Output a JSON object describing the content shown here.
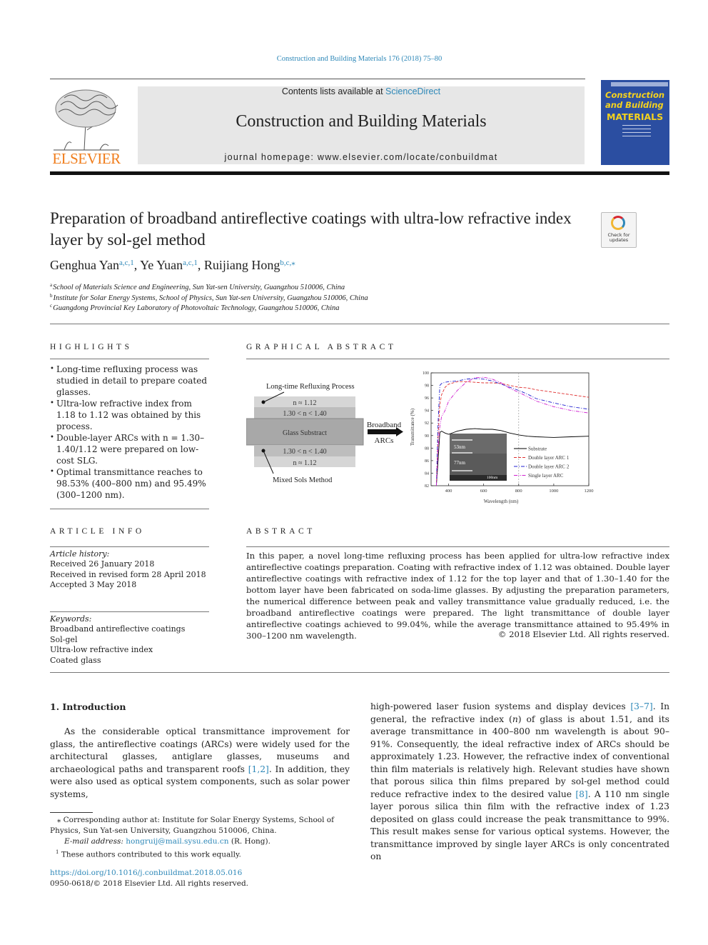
{
  "header": {
    "citation": "Construction and Building Materials 176 (2018) 75–80",
    "contents_prefix": "Contents lists available at ",
    "contents_link": "ScienceDirect",
    "journal_name": "Construction and Building Materials",
    "homepage": "journal homepage: www.elsevier.com/locate/conbuildmat",
    "publisher_logo_text": "ELSEVIER",
    "cover": {
      "line1": "Construction",
      "line2": "and Building",
      "line3": "MATERIALS"
    }
  },
  "article": {
    "title": "Preparation of broadband antireflective coatings with ultra-low refractive index layer by sol-gel method",
    "check_badge": {
      "line1": "Check for",
      "line2": "updates"
    },
    "authors": [
      {
        "name": "Genghua Yan",
        "sup": "a,c,1",
        "sep": ", "
      },
      {
        "name": "Ye Yuan",
        "sup": "a,c,1",
        "sep": ", "
      },
      {
        "name": "Ruijiang Hong",
        "sup": "b,c,⁎",
        "sep": ""
      }
    ],
    "affiliations": [
      {
        "mark": "a",
        "text": "School of Materials Science and Engineering, Sun Yat-sen University, Guangzhou 510006, China"
      },
      {
        "mark": "b",
        "text": "Institute for Solar Energy Systems, School of Physics, Sun Yat-sen University, Guangzhou 510006, China"
      },
      {
        "mark": "c",
        "text": "Guangdong Provincial Key Laboratory of Photovoltaic Technology, Guangzhou 510006, China"
      }
    ]
  },
  "highlights": {
    "heading": "HIGHLIGHTS",
    "items": [
      "Long-time refluxing process was studied in detail to prepare coated glasses.",
      "Ultra-low refractive index from 1.18 to 1.12 was obtained by this process.",
      "Double-layer ARCs with n = 1.30–1.40/1.12 were prepared on low-cost SLG.",
      "Optimal transmittance reaches to 98.53% (400–800 nm) and 95.49% (300–1200 nm)."
    ]
  },
  "graphical_abstract": {
    "heading": "GRAPHICAL ABSTRACT",
    "schematic": {
      "top_label": "Long-time Refluxing Process",
      "bottom_label": "Mixed Sols Method",
      "layers": [
        "n ≈ 1.12",
        "1.30 < n < 1.40",
        "Glass Substract",
        "1.30 < n < 1.40",
        "n ≈ 1.12"
      ],
      "arrow_label_1": "Broadband",
      "arrow_label_2": "ARCs"
    },
    "inset": {
      "label_top": "53nm",
      "label_bottom": "77nm",
      "scale": "100nm"
    }
  },
  "chart_data": {
    "type": "line",
    "title": "",
    "xlabel": "Wavelength (nm)",
    "ylabel": "Transmittance (%)",
    "xlim": [
      300,
      1200
    ],
    "ylim": [
      82,
      100
    ],
    "xticks": [
      400,
      600,
      800,
      1000,
      1200
    ],
    "yticks": [
      82,
      84,
      86,
      88,
      90,
      92,
      94,
      96,
      98,
      100
    ],
    "reference_line_x": 800,
    "legend_position": "bottom-right",
    "x": [
      330,
      340,
      350,
      360,
      380,
      400,
      450,
      500,
      550,
      600,
      650,
      700,
      750,
      800,
      850,
      900,
      1000,
      1100,
      1200
    ],
    "series": [
      {
        "name": "Substrate",
        "color": "#000000",
        "dash": "solid",
        "values": [
          82,
          86,
          90.5,
          90.7,
          90.4,
          90.2,
          90.7,
          91.0,
          91.1,
          91.0,
          91.0,
          90.8,
          90.4,
          90.1,
          89.9,
          89.8,
          89.7,
          89.8,
          89.9
        ]
      },
      {
        "name": "Double layer ARC 1",
        "color": "#e03030",
        "dash": "dashed",
        "values": [
          82,
          90,
          95.0,
          96.5,
          97.7,
          98.2,
          98.6,
          98.6,
          98.5,
          98.4,
          98.4,
          98.3,
          98.0,
          97.7,
          97.6,
          97.3,
          96.9,
          96.5,
          96.1
        ]
      },
      {
        "name": "Double layer ARC 2",
        "color": "#2020d0",
        "dash": "dashdot",
        "values": [
          82,
          92,
          98.0,
          98.3,
          98.5,
          98.6,
          98.7,
          99.0,
          99.1,
          99.0,
          98.7,
          98.2,
          97.7,
          97.2,
          96.6,
          95.9,
          95.2,
          94.6,
          94.2
        ]
      },
      {
        "name": "Single layer ARC",
        "color": "#d020d0",
        "dash": "dashdotdot",
        "values": [
          82,
          88,
          91.5,
          93.0,
          94.0,
          95.5,
          97.2,
          98.5,
          99.2,
          99.3,
          99.0,
          98.4,
          97.5,
          96.9,
          96.2,
          95.5,
          94.6,
          94.0,
          93.6
        ]
      }
    ]
  },
  "article_info": {
    "heading": "ARTICLE INFO",
    "history_label": "Article history:",
    "history": [
      "Received 26 January 2018",
      "Received in revised form 28 April 2018",
      "Accepted 3 May 2018"
    ],
    "keywords_label": "Keywords:",
    "keywords": [
      "Broadband antireflective coatings",
      "Sol-gel",
      "Ultra-low refractive index",
      "Coated glass"
    ]
  },
  "abstract": {
    "heading": "ABSTRACT",
    "text": "In this paper, a novel long-time refluxing process has been applied for ultra-low refractive index antireflective coatings preparation. Coating with refractive index of 1.12 was obtained. Double layer antireflective coatings with refractive index of 1.12 for the top layer and that of 1.30–1.40 for the bottom layer have been fabricated on soda-lime glasses. By adjusting the preparation parameters, the numerical difference between peak and valley transmittance value gradually reduced, i.e. the broadband antireflective coatings were prepared. The light transmittance of double layer antireflective coatings achieved to 99.04%, while the average transmittance attained to 95.49% in 300–1200 nm wavelength.",
    "copyright": "© 2018 Elsevier Ltd. All rights reserved."
  },
  "introduction": {
    "heading": "1. Introduction",
    "left_before_ref": "As the considerable optical transmittance improvement for glass, the antireflective coatings (ARCs) were widely used for the architectural glasses, antiglare glasses, museums and archaeological paths and transparent roofs ",
    "left_ref": "[1,2]",
    "left_after_ref": ". In addition, they were also used as optical system components, such as solar power systems,",
    "right_p1": "high-powered laser fusion systems and display devices ",
    "right_ref1": "[3–7]",
    "right_p2": ". In general, the refractive index (",
    "right_n": "n",
    "right_p3": ") of glass is about 1.51, and its average transmittance in 400–800 nm wavelength is about 90–91%. Consequently, the ideal refractive index of ARCs should be approximately 1.23. However, the refractive index of conventional thin film materials is relatively high. Relevant studies have shown that porous silica thin films prepared by sol-gel method could reduce refractive index to the desired value ",
    "right_ref2": "[8]",
    "right_p4": ". A 110 nm single layer porous silica thin film with the refractive index of 1.23 deposited on glass could increase the peak transmittance to 99%. This result makes sense for various optical systems. However, the transmittance improved by single layer ARCs is only concentrated on"
  },
  "footnotes": {
    "corresponding": "⁎ Corresponding author at: Institute for Solar Energy Systems, School of Physics, Sun Yat-sen University, Guangzhou 510006, China.",
    "email_label": "E-mail address: ",
    "email": "hongruij@mail.sysu.edu.cn",
    "email_suffix": " (R. Hong).",
    "equal_mark": "1",
    "equal": "These authors contributed to this work equally.",
    "doi": "https://doi.org/10.1016/j.conbuildmat.2018.05.016",
    "issn": "0950-0618/© 2018 Elsevier Ltd. All rights reserved."
  }
}
